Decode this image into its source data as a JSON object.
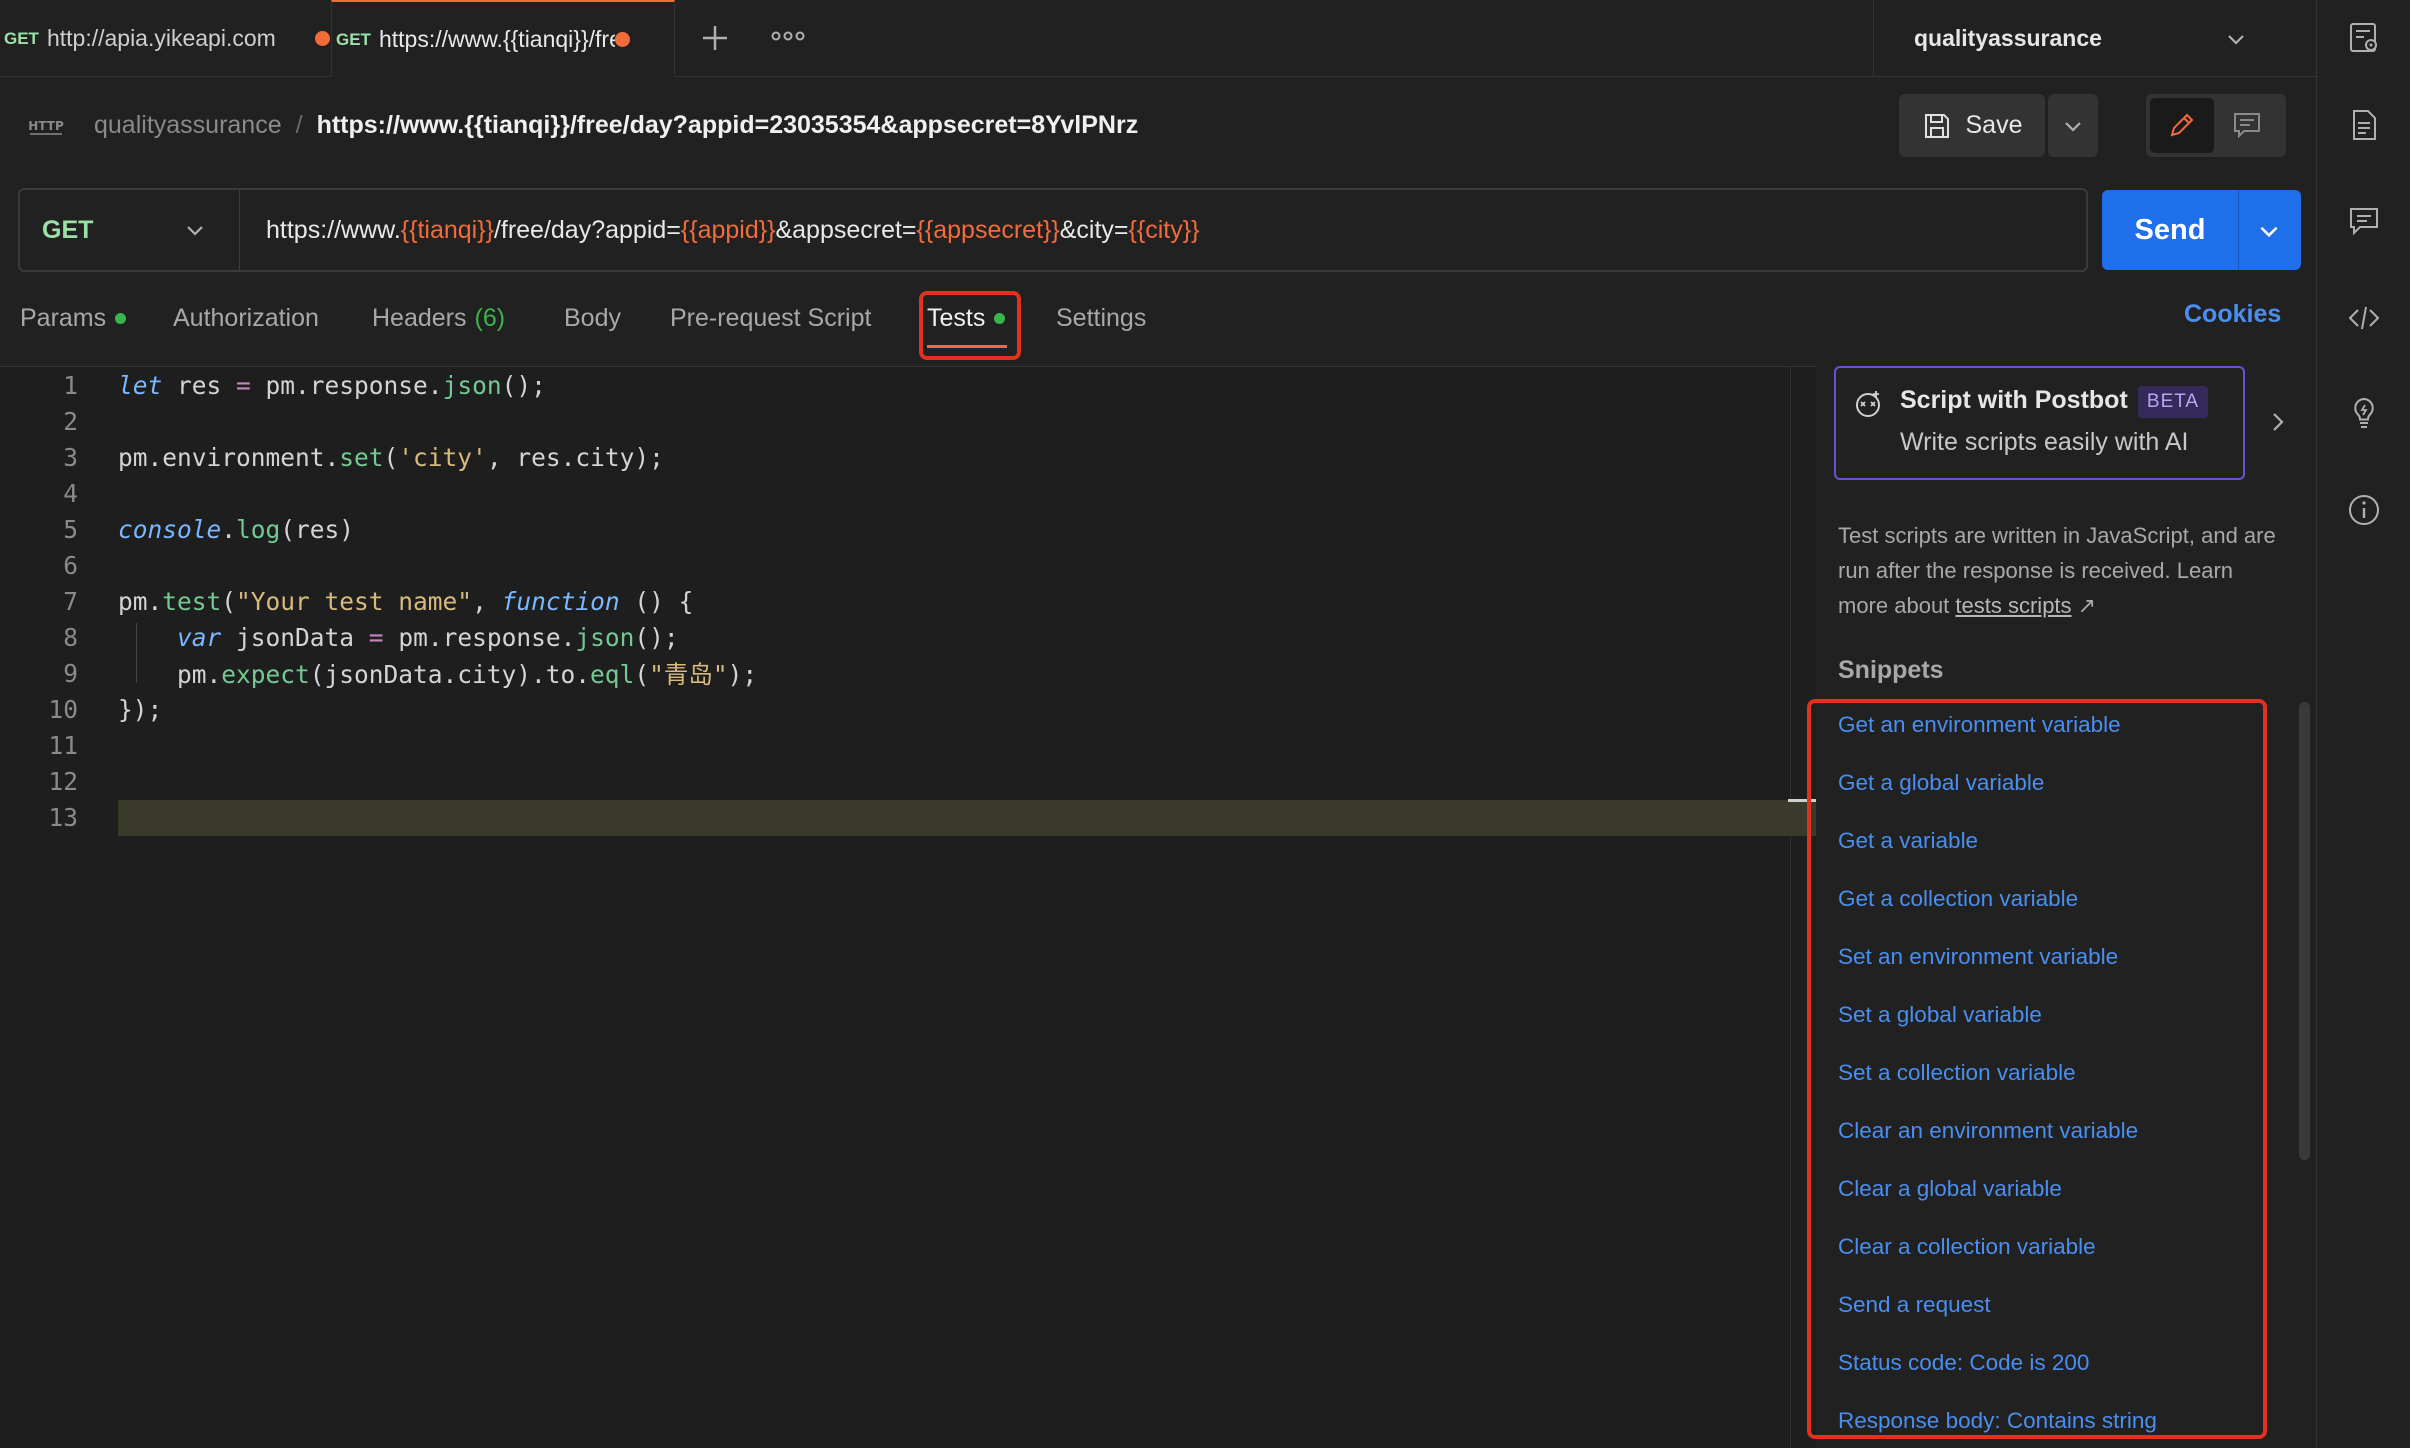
{
  "tabs": [
    {
      "method": "GET",
      "label": "http://apia.yikeapi.com"
    },
    {
      "method": "GET",
      "label": "https://www.{{tianqi}}/free/day?appid"
    }
  ],
  "workspace": "qualityassurance",
  "breadcrumb": {
    "collection": "qualityassurance",
    "separator": "/",
    "request_name": "https://www.{{tianqi}}/free/day?appid=23035354&appsecret=8YvlPNrz"
  },
  "toolbar": {
    "save_label": "Save"
  },
  "request": {
    "method": "GET",
    "url_parts": [
      {
        "text": "https://www.",
        "var": false
      },
      {
        "text": "{{tianqi}}",
        "var": true
      },
      {
        "text": "/free/day?appid=",
        "var": false
      },
      {
        "text": "{{appid}}",
        "var": true
      },
      {
        "text": "&appsecret=",
        "var": false
      },
      {
        "text": "{{appsecret}}",
        "var": true
      },
      {
        "text": "&city=",
        "var": false
      },
      {
        "text": "{{city}}",
        "var": true
      }
    ],
    "send_label": "Send"
  },
  "request_tabs": {
    "params": "Params",
    "authorization": "Authorization",
    "headers": "Headers",
    "headers_count": "(6)",
    "body": "Body",
    "pre_request": "Pre-request Script",
    "tests": "Tests",
    "settings": "Settings",
    "cookies": "Cookies"
  },
  "code_lines": [
    "1",
    "2",
    "3",
    "4",
    "5",
    "6",
    "7",
    "8",
    "9",
    "10",
    "11",
    "12",
    "13"
  ],
  "postbot": {
    "title": "Script with Postbot",
    "badge": "BETA",
    "subtitle": "Write scripts easily with AI"
  },
  "help": {
    "text": "Test scripts are written in JavaScript, and are run after the response is received. Learn more about ",
    "link": "tests scripts",
    "arrow": "↗"
  },
  "snippets_title": "Snippets",
  "snippets": [
    "Get an environment variable",
    "Get a global variable",
    "Get a variable",
    "Get a collection variable",
    "Set an environment variable",
    "Set a global variable",
    "Set a collection variable",
    "Clear an environment variable",
    "Clear a global variable",
    "Clear a collection variable",
    "Send a request",
    "Status code: Code is 200",
    "Response body: Contains string"
  ],
  "colors": {
    "accent_orange": "#f26b3a",
    "send_blue": "#1f6feb",
    "link_blue": "#4a8ef0",
    "status_green": "#39b54a",
    "highlight_red": "#e0321f",
    "postbot_purple": "#6b4fd6"
  }
}
